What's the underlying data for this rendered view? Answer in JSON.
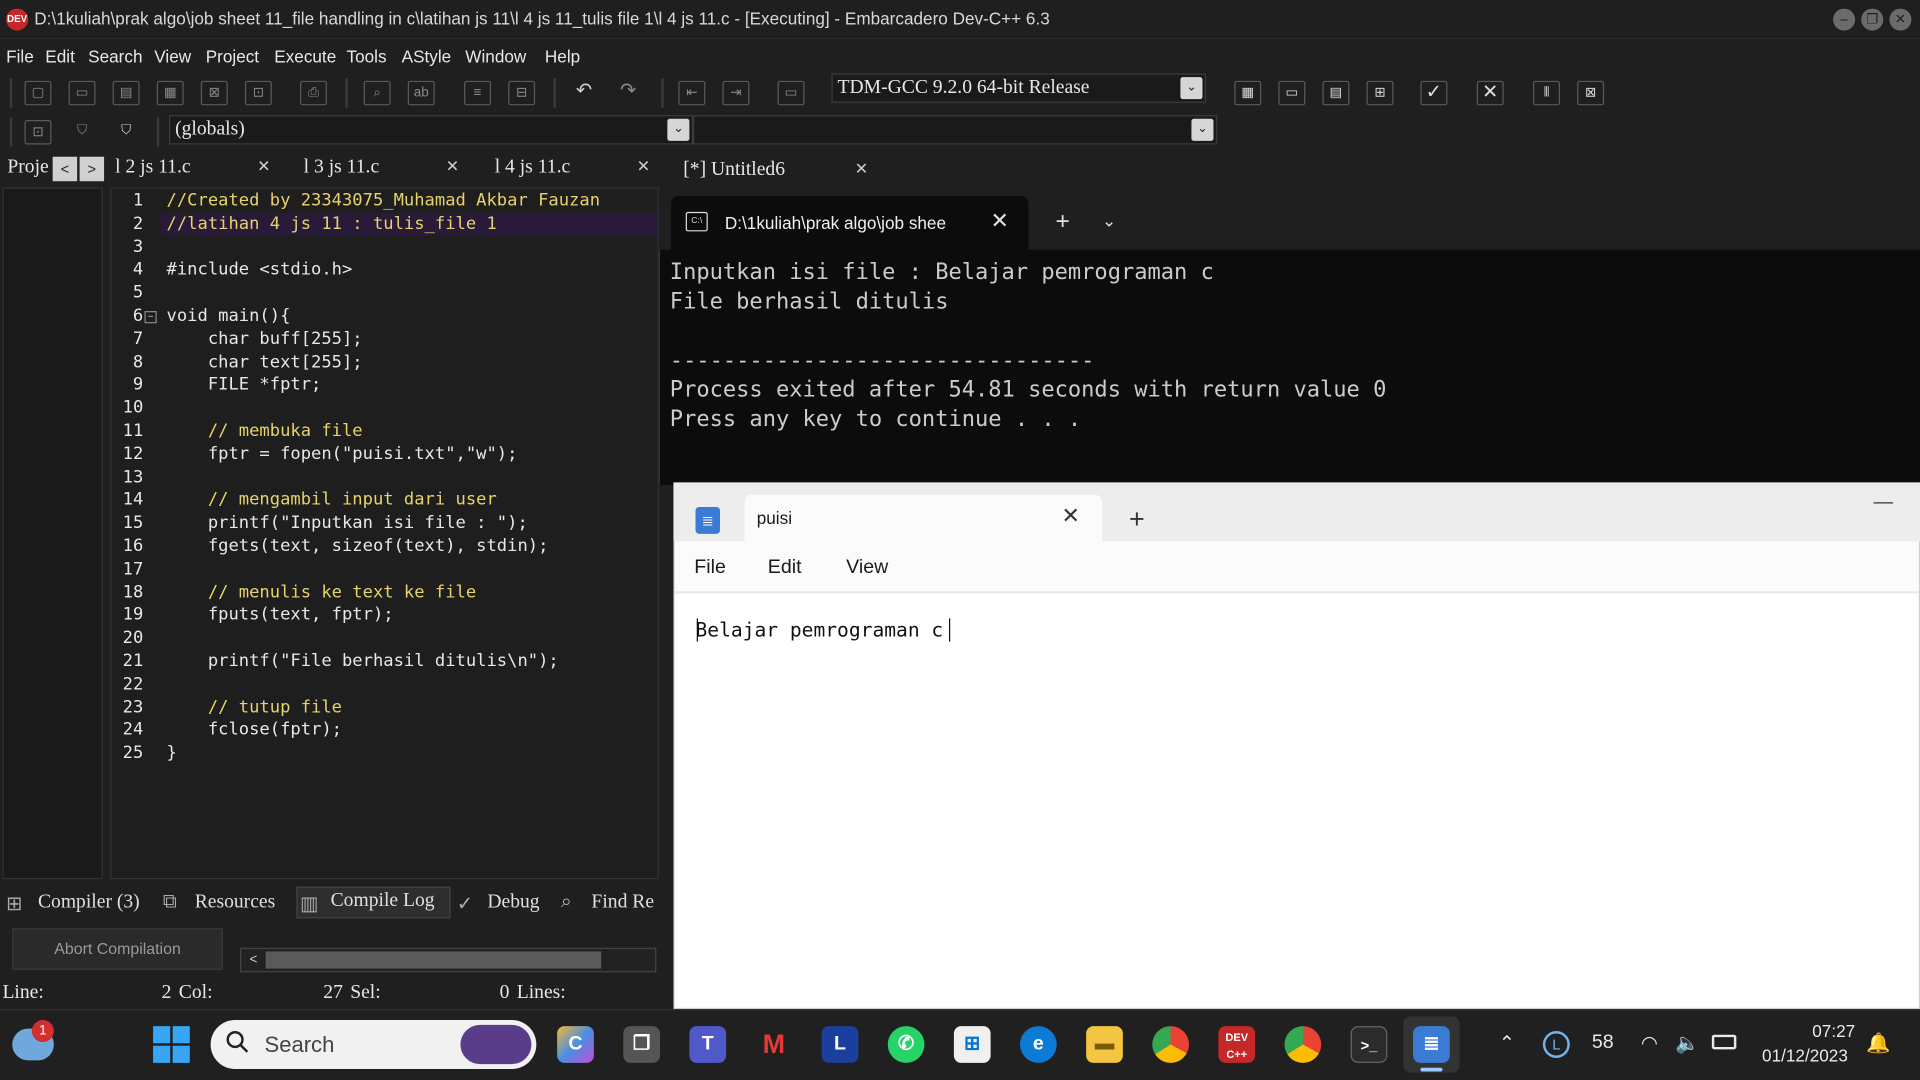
{
  "window": {
    "title": "D:\\1kuliah\\prak algo\\job sheet 11_file handling in c\\latihan js 11\\l 4 js 11_tulis file 1\\l 4 js 11.c - [Executing] - Embarcadero Dev-C++ 6.3",
    "app_icon": "DEV"
  },
  "menu": [
    "File",
    "Edit",
    "Search",
    "View",
    "Project",
    "Execute",
    "Tools",
    "AStyle",
    "Window",
    "Help"
  ],
  "toolbar": {
    "compiler": "TDM-GCC 9.2.0 64-bit Release",
    "scope": "(globals)"
  },
  "file_tabs": {
    "project_tab": "Proje",
    "tabs": [
      "l 2 js 11.c",
      "l 3 js 11.c",
      "l 4 js 11.c",
      "[*] Untitled6"
    ]
  },
  "editor": {
    "line_numbers": [
      "1",
      "2",
      "3",
      "4",
      "5",
      "6",
      "7",
      "8",
      "9",
      "10",
      "11",
      "12",
      "13",
      "14",
      "15",
      "16",
      "17",
      "18",
      "19",
      "20",
      "21",
      "22",
      "23",
      "24",
      "25"
    ],
    "lines": [
      "//Created by 23343075_Muhamad Akbar Fauzan",
      "//latihan 4 js 11 : tulis_file 1",
      "",
      "#include <stdio.h>",
      "",
      "void main(){",
      "    char buff[255];",
      "    char text[255];",
      "    FILE *fptr;",
      "",
      "    // membuka file",
      "    fptr = fopen(\"puisi.txt\",\"w\");",
      "",
      "    // mengambil input dari user",
      "    printf(\"Inputkan isi file : \");",
      "    fgets(text, sizeof(text), stdin);",
      "",
      "    // menulis ke text ke file",
      "    fputs(text, fptr);",
      "",
      "    printf(\"File berhasil ditulis\\n\");",
      "",
      "    // tutup file",
      "    fclose(fptr);",
      "}"
    ]
  },
  "bottom_tabs": [
    "Compiler (3)",
    "Resources",
    "Compile Log",
    "Debug",
    "Find Re"
  ],
  "abort_button": "Abort Compilation",
  "statusbar": {
    "line_label": "Line:",
    "line_value": "2",
    "col_label": "Col:",
    "col_value": "27",
    "sel_label": "Sel:",
    "sel_value": "0",
    "lines_label": "Lines:"
  },
  "terminal": {
    "tab_title": "D:\\1kuliah\\prak algo\\job shee",
    "output": [
      "Inputkan isi file : Belajar pemrograman c",
      "File berhasil ditulis",
      "",
      "--------------------------------",
      "Process exited after 54.81 seconds with return value 0",
      "Press any key to continue . . ."
    ]
  },
  "notepad": {
    "tab_title": "puisi",
    "menu": [
      "File",
      "Edit",
      "View"
    ],
    "content": "Belajar pemrograman c"
  },
  "taskbar": {
    "weather_badge": "1",
    "search_placeholder": "Search",
    "battery_level": "58",
    "time": "07:27",
    "date": "01/12/2023"
  }
}
